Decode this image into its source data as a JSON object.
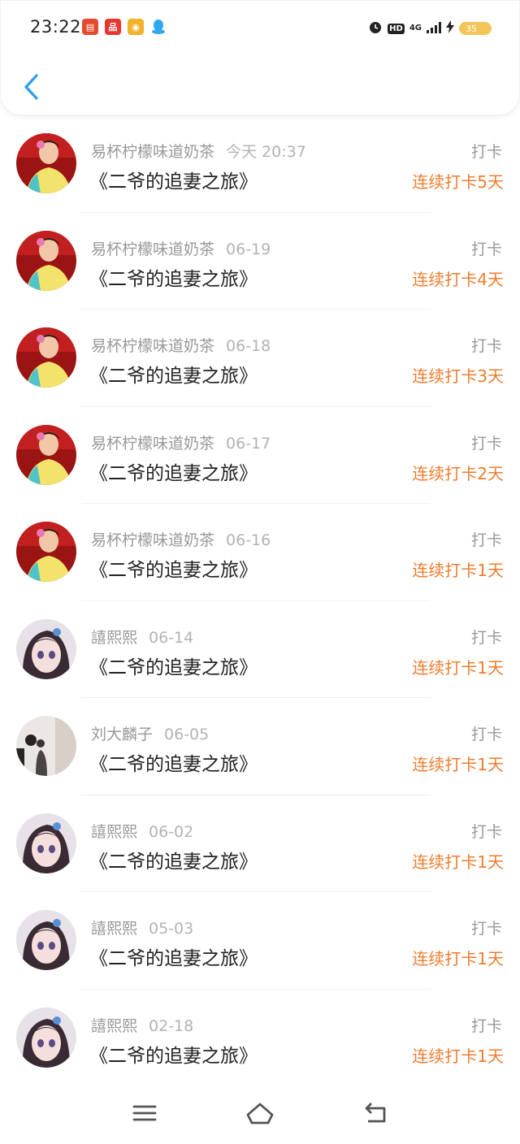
{
  "status_bar": {
    "time": "23:22",
    "notifications": [
      {
        "icon": "app-red-icon",
        "glyph": "▤"
      },
      {
        "icon": "app-red-icon",
        "glyph": "品"
      },
      {
        "icon": "weibo-icon",
        "glyph": "◉"
      },
      {
        "icon": "qq-icon",
        "glyph": "♟"
      }
    ],
    "hd_label": "HD",
    "network_label": "4G",
    "battery_level": "35"
  },
  "header": {
    "back_icon": "chevron-left-icon",
    "accent_color": "#2b9cf2"
  },
  "records": [
    {
      "user": "易杯柠檬味道奶茶",
      "date": "今天 20:37",
      "book": "《二爷的追妻之旅》",
      "action": "打卡",
      "streak": "连续打卡5天",
      "avatar": "man"
    },
    {
      "user": "易杯柠檬味道奶茶",
      "date": "06-19",
      "book": "《二爷的追妻之旅》",
      "action": "打卡",
      "streak": "连续打卡4天",
      "avatar": "man"
    },
    {
      "user": "易杯柠檬味道奶茶",
      "date": "06-18",
      "book": "《二爷的追妻之旅》",
      "action": "打卡",
      "streak": "连续打卡3天",
      "avatar": "man"
    },
    {
      "user": "易杯柠檬味道奶茶",
      "date": "06-17",
      "book": "《二爷的追妻之旅》",
      "action": "打卡",
      "streak": "连续打卡2天",
      "avatar": "man"
    },
    {
      "user": "易杯柠檬味道奶茶",
      "date": "06-16",
      "book": "《二爷的追妻之旅》",
      "action": "打卡",
      "streak": "连续打卡1天",
      "avatar": "man"
    },
    {
      "user": "譆熙熙",
      "date": "06-14",
      "book": "《二爷的追妻之旅》",
      "action": "打卡",
      "streak": "连续打卡1天",
      "avatar": "anime"
    },
    {
      "user": "刘大麟子",
      "date": "06-05",
      "book": "《二爷的追妻之旅》",
      "action": "打卡",
      "streak": "连续打卡1天",
      "avatar": "photo"
    },
    {
      "user": "譆熙熙",
      "date": "06-02",
      "book": "《二爷的追妻之旅》",
      "action": "打卡",
      "streak": "连续打卡1天",
      "avatar": "anime"
    },
    {
      "user": "譆熙熙",
      "date": "05-03",
      "book": "《二爷的追妻之旅》",
      "action": "打卡",
      "streak": "连续打卡1天",
      "avatar": "anime"
    },
    {
      "user": "譆熙熙",
      "date": "02-18",
      "book": "《二爷的追妻之旅》",
      "action": "打卡",
      "streak": "连续打卡1天",
      "avatar": "anime"
    }
  ],
  "colors": {
    "streak": "#f07c2e",
    "meta": "#999999"
  },
  "nav_bar": {
    "menu_icon": "menu-icon",
    "home_icon": "home-icon",
    "back_icon": "back-icon"
  }
}
